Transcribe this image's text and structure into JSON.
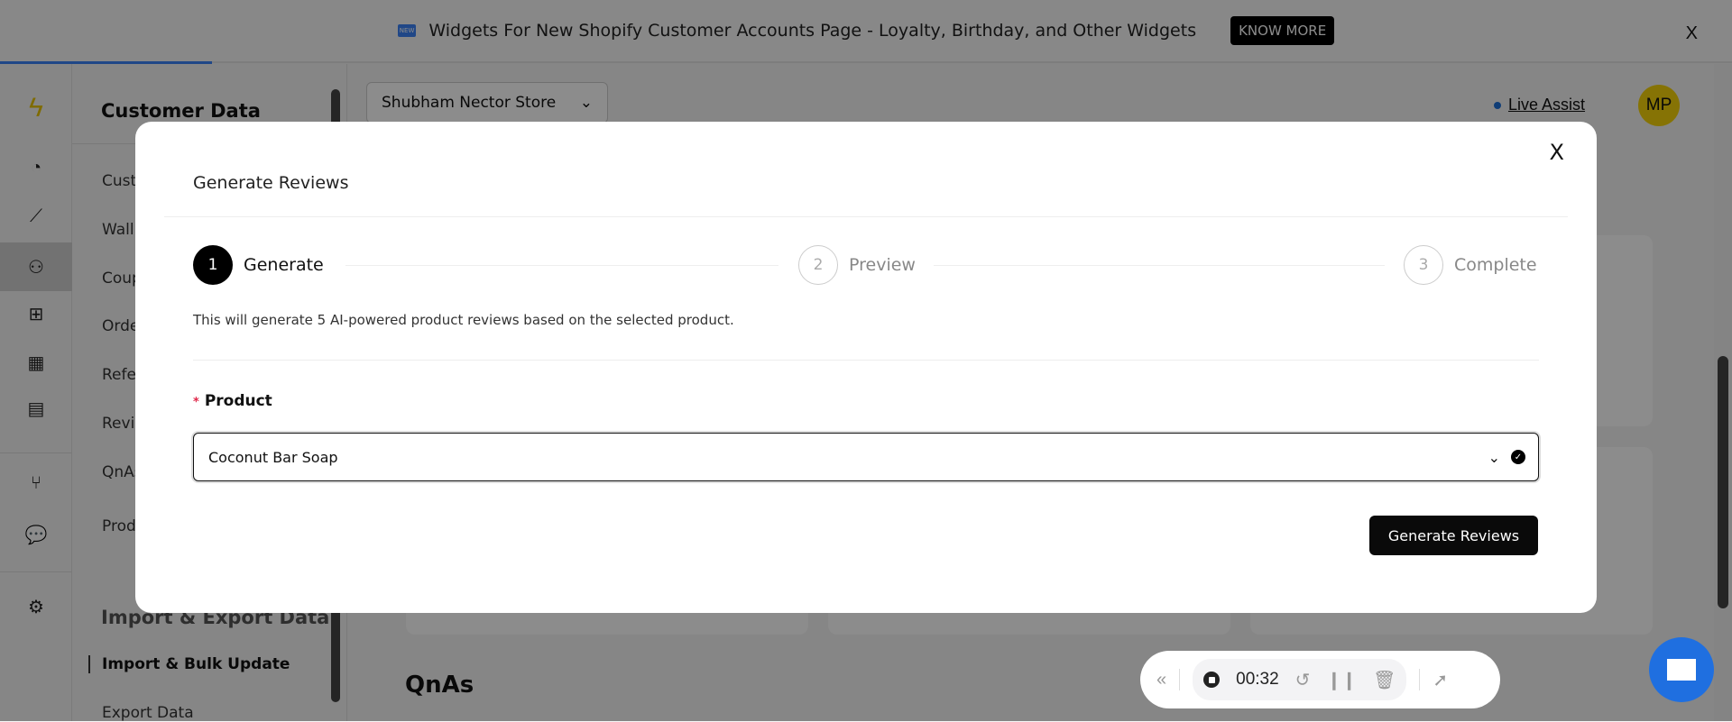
{
  "banner": {
    "badge": "NEW",
    "text": "Widgets For New Shopify Customer Accounts Page - Loyalty, Birthday, and Other Widgets",
    "cta": "KNOW MORE",
    "close": "X"
  },
  "rail": {
    "icons": [
      "bolt-logo-icon",
      "pie-chart-icon",
      "line-chart-icon",
      "user-icon",
      "gift-icon",
      "grid-add-icon",
      "layout-icon",
      "branch-icon",
      "chat-icon",
      "settings-icon"
    ],
    "active": "user-icon"
  },
  "subsidebar": {
    "section1": "Customer Data",
    "items": [
      "Cust",
      "Wall",
      "Coup",
      "Orde",
      "Refe",
      "Revie",
      "QnAs",
      "Prod"
    ],
    "section2": "Import & Export Data",
    "items2": [
      "Import & Bulk Update",
      "Export Data"
    ]
  },
  "header": {
    "store": "Shubham Nector Store",
    "live_assist": "Live Assist",
    "avatar": "MP"
  },
  "main": {
    "qnas_heading": "QnAs"
  },
  "modal": {
    "title": "Generate Reviews",
    "close": "X",
    "steps": [
      {
        "num": "1",
        "label": "Generate",
        "state": "active"
      },
      {
        "num": "2",
        "label": "Preview",
        "state": "pending"
      },
      {
        "num": "3",
        "label": "Complete",
        "state": "pending"
      }
    ],
    "description": "This will generate 5 AI-powered product reviews based on the selected product.",
    "product_label": "Product",
    "required_mark": "*",
    "product_value": "Coconut Bar Soap",
    "generate_button": "Generate Reviews"
  },
  "recorder": {
    "time": "00:32"
  },
  "colors": {
    "accent": "#1f6fe0",
    "avatar": "#f4d20a",
    "required": "#e0284a"
  }
}
